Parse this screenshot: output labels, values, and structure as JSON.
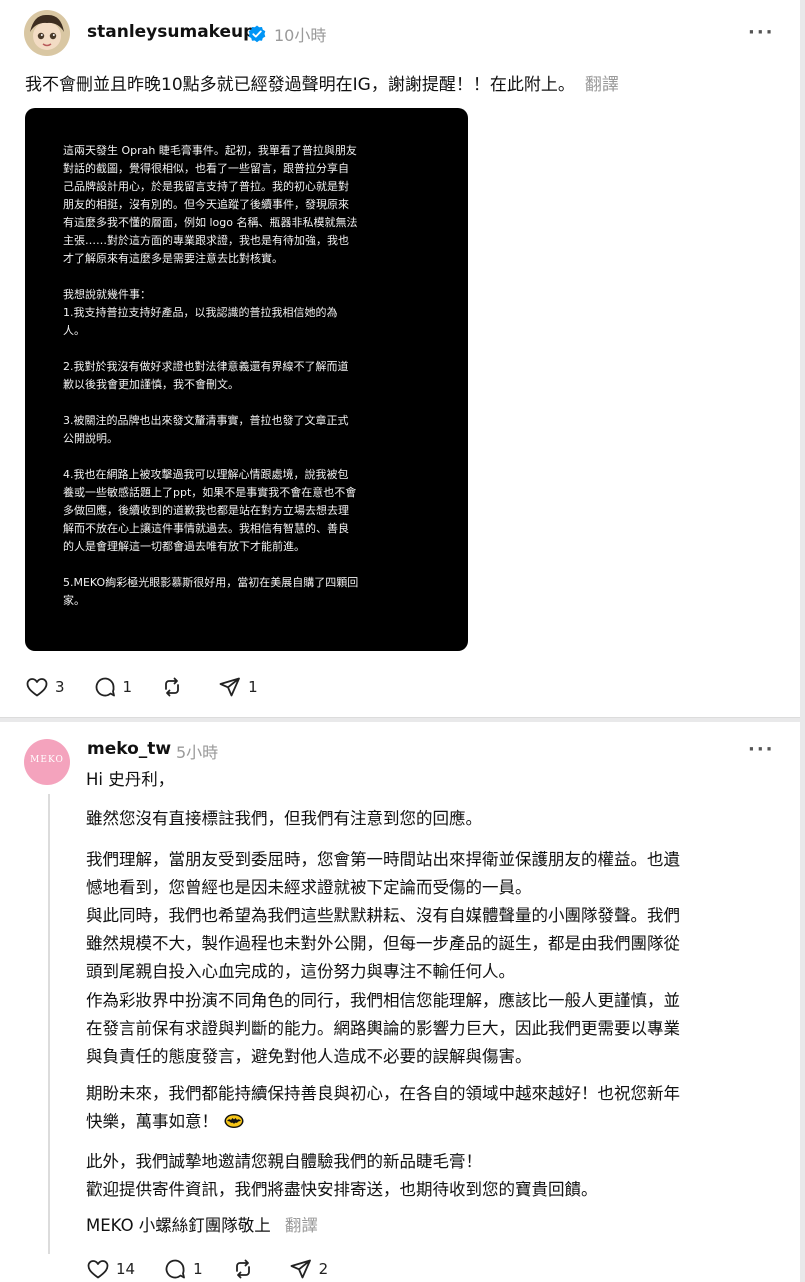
{
  "post1": {
    "username": "stanleysumakeup",
    "time": "10小時",
    "more": "···",
    "text": "我不會刪並且昨晚10點多就已經發過聲明在IG，謝謝提醒！！在此附上。",
    "translate": "翻譯",
    "notice": {
      "paragraphs": [
        "這兩天發生 Oprah 睫毛膏事件。起初，我單看了普拉與朋友\n對話的截圖，覺得很相似，也看了一些留言，跟普拉分享自\n己品牌設計用心，於是我留言支持了普拉。我的初心就是對\n朋友的相挺，沒有別的。但今天追蹤了後續事件，發現原來\n有這麼多我不懂的層面，例如 logo 名稱、瓶器非私模就無法\n主張……對於這方面的專業跟求證，我也是有待加強，我也\n才了解原來有這麼多是需要注意去比對核實。",
        "我想說就幾件事：\n1.我支持普拉支持好產品，以我認識的普拉我相信她的為\n人。",
        "2.我對於我沒有做好求證也對法律意義還有界線不了解而道\n歉以後我會更加謹慎，我不會刪文。",
        "3.被關注的品牌也出來發文釐清事實，普拉也發了文章正式\n公開說明。",
        "4.我也在網路上被攻擊過我可以理解心情跟處境，說我被包\n養或一些敏感話題上了ppt，如果不是事實我不會在意也不會\n多做回應，後續收到的道歉我也都是站在對方立場去想去理\n解而不放在心上讓這件事情就過去。我相信有智慧的、善良\n的人是會理解這一切都會過去唯有放下才能前進。",
        "5.MEKO絢彩極光眼影慕斯很好用，當初在美展自購了四顆回\n家。"
      ]
    },
    "likes": "3",
    "comments": "1",
    "shares": "1"
  },
  "post2": {
    "username": "meko_tw",
    "time": "5小時",
    "more": "···",
    "avatar_text": "MEKO",
    "greeting": "Hi 史丹利，",
    "p1": "雖然您沒有直接標註我們，但我們有注意到您的回應。",
    "p2": [
      "我們理解，當朋友受到委屈時，您會第一時間站出來捍衛並保護朋友的權益。也遺",
      "憾地看到，您曾經也是因未經求證就被下定論而受傷的一員。",
      "與此同時，我們也希望為我們這些默默耕耘、沒有自媒體聲量的小團隊發聲。我們",
      "雖然規模不大，製作過程也未對外公開，但每一步產品的誕生，都是由我們團隊從",
      "頭到尾親自投入心血完成的，這份努力與專注不輸任何人。"
    ],
    "p3": [
      "作為彩妝界中扮演不同角色的同行，我們相信您能理解，應該比一般人更謹慎，並",
      "在發言前保有求證與判斷的能力。網路輿論的影響力巨大，因此我們更需要以專業",
      "與負責任的態度發言，避免對他人造成不必要的誤解與傷害。"
    ],
    "p4": [
      "期盼未來，我們都能持續保持善良與初心，在各自的領域中越來越好！也祝您新年",
      "快樂，萬事如意！"
    ],
    "p5": [
      "此外，我們誠摯地邀請您親自體驗我們的新品睫毛膏！",
      "歡迎提供寄件資訊，我們將盡快安排寄送，也期待收到您的寶貴回饋。"
    ],
    "signature": "MEKO 小螺絲釘團隊敬上",
    "translate": "翻譯",
    "likes": "14",
    "comments": "1",
    "shares": "2"
  }
}
